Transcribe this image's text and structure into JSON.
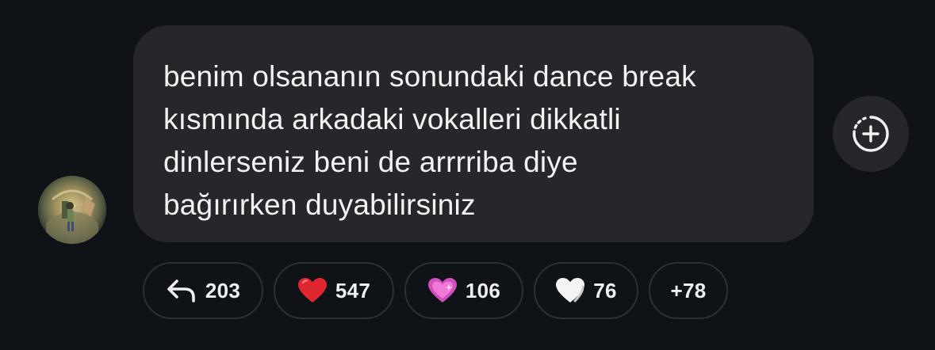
{
  "message": {
    "lines": [
      "benim olsananın sonundaki dance break",
      "kısmında arkadaki vokalleri dikkatli",
      "dinlerseniz beni de arrrriba diye",
      "bağırırken duyabilirsiniz"
    ]
  },
  "reactions": {
    "reply": {
      "icon": "reply-arrow-icon",
      "count": "203"
    },
    "red_heart": {
      "icon": "red-heart-icon",
      "count": "547",
      "color": "#e0262f"
    },
    "pink_heart": {
      "icon": "sparkling-pink-heart-icon",
      "count": "106",
      "color": "#d04fc0"
    },
    "white_heart": {
      "icon": "white-heart-icon",
      "count": "76",
      "color": "#f4f4f4"
    },
    "more": {
      "label": "+78"
    }
  },
  "add_reaction": {
    "icon": "add-reaction-icon"
  },
  "colors": {
    "background": "#0f1216",
    "bubble": "#25272b",
    "text": "#f2f3f5",
    "pill_border": "#2c2f34"
  }
}
